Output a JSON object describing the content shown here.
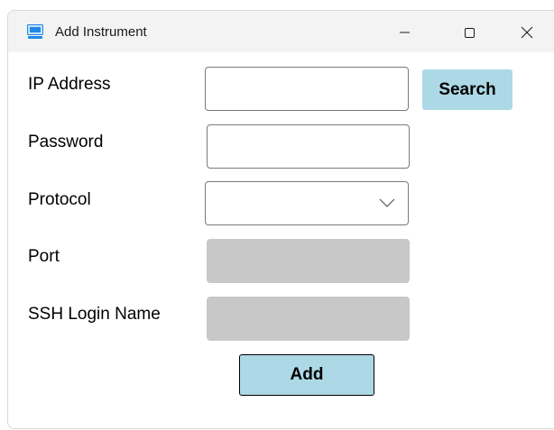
{
  "window": {
    "title": "Add Instrument",
    "icon": "monitor-icon",
    "controls": [
      "minimize-icon",
      "maximize-icon",
      "close-icon"
    ]
  },
  "form": {
    "ip_address": {
      "label": "IP Address",
      "value": "",
      "placeholder": ""
    },
    "password": {
      "label": "Password",
      "value": "",
      "placeholder": ""
    },
    "protocol": {
      "label": "Protocol",
      "selected": ""
    },
    "port": {
      "label": "Port",
      "value": ""
    },
    "ssh_login_name": {
      "label": "SSH Login Name",
      "value": ""
    }
  },
  "buttons": {
    "search_label": "Search",
    "add_label": "Add"
  },
  "colors": {
    "button_bg": "#add8e6",
    "disabled_field": "#c8c8c8",
    "titlebar_bg": "#f3f3f3",
    "icon_blue": "#1e88e5"
  }
}
